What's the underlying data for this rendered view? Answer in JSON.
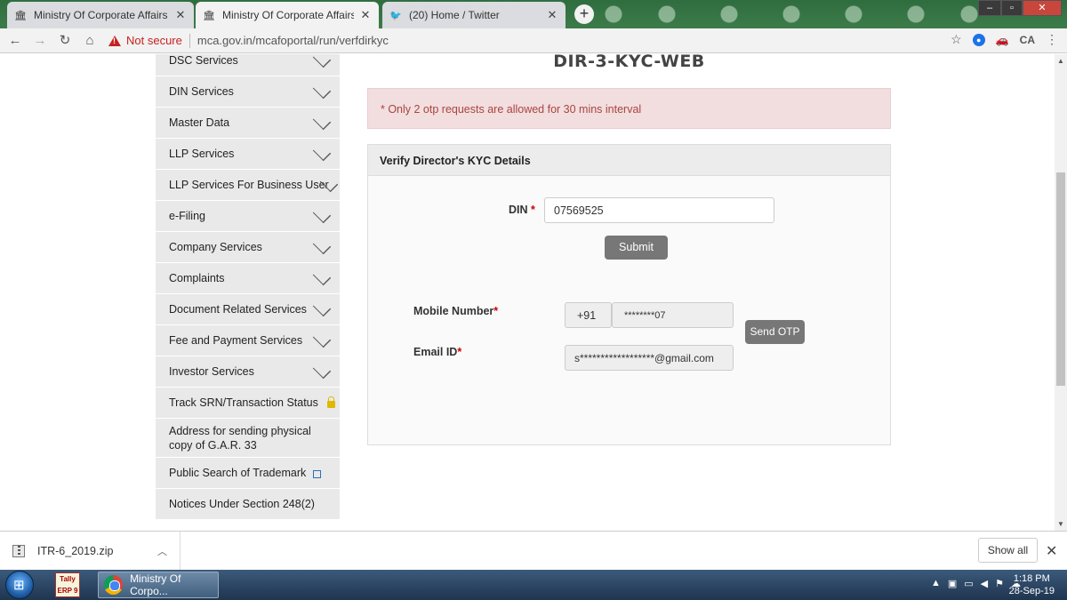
{
  "browser": {
    "tabs": [
      {
        "label": "Ministry Of Corporate Affairs - Gr",
        "icon": "emblem-icon",
        "active": false
      },
      {
        "label": "Ministry Of Corporate Affairs - M",
        "icon": "emblem-icon",
        "active": true
      },
      {
        "label": "(20) Home / Twitter",
        "icon": "twitter-icon",
        "active": false
      }
    ],
    "new_tab": "+",
    "security_label": "Not secure",
    "url": "mca.gov.in/mcafoportal/run/verfdirkyc",
    "colors": {
      "warning": "#c5221f",
      "chrome": "#f2f2f2"
    }
  },
  "sidebar": {
    "items": [
      {
        "label": "DSC Services",
        "chevron": true
      },
      {
        "label": "DIN Services",
        "chevron": true
      },
      {
        "label": "Master Data",
        "chevron": true
      },
      {
        "label": "LLP Services",
        "chevron": true
      },
      {
        "label": "LLP Services For Business User",
        "chevron": true
      },
      {
        "label": "e-Filing",
        "chevron": true
      },
      {
        "label": "Company Services",
        "chevron": true
      },
      {
        "label": "Complaints",
        "chevron": true
      },
      {
        "label": "Document Related Services",
        "chevron": true
      },
      {
        "label": "Fee and Payment Services",
        "chevron": true
      },
      {
        "label": "Investor Services",
        "chevron": true
      },
      {
        "label": "Track SRN/Transaction Status",
        "icon": "lock-icon"
      },
      {
        "label": "Address for sending physical copy of G.A.R. 33"
      },
      {
        "label": "Public Search of Trademark",
        "icon": "external-link-icon"
      },
      {
        "label": "Notices Under Section 248(2)"
      }
    ]
  },
  "main": {
    "title": "DIR-3-KYC-WEB",
    "alert": "* Only 2 otp requests are allowed for 30 mins interval",
    "panel_title": "Verify Director's KYC Details",
    "din_label": "DIN",
    "din_value": "07569525",
    "submit_label": "Submit",
    "mobile_label": "Mobile Number",
    "country_code": "+91",
    "mobile_value": "********07",
    "send_otp_label": "Send OTP",
    "email_label": "Email ID",
    "email_value": "s******************@gmail.com",
    "required_mark": "*",
    "colors": {
      "alert_bg": "#f2dede",
      "alert_text": "#a94442",
      "button": "#777777"
    }
  },
  "downloads": {
    "file_name": "ITR-6_2019.zip",
    "show_all_label": "Show all"
  },
  "taskbar": {
    "tally_label": "Tally ERP 9",
    "window_label": "Ministry Of Corpo...",
    "time": "1:18 PM",
    "date": "28-Sep-19"
  }
}
